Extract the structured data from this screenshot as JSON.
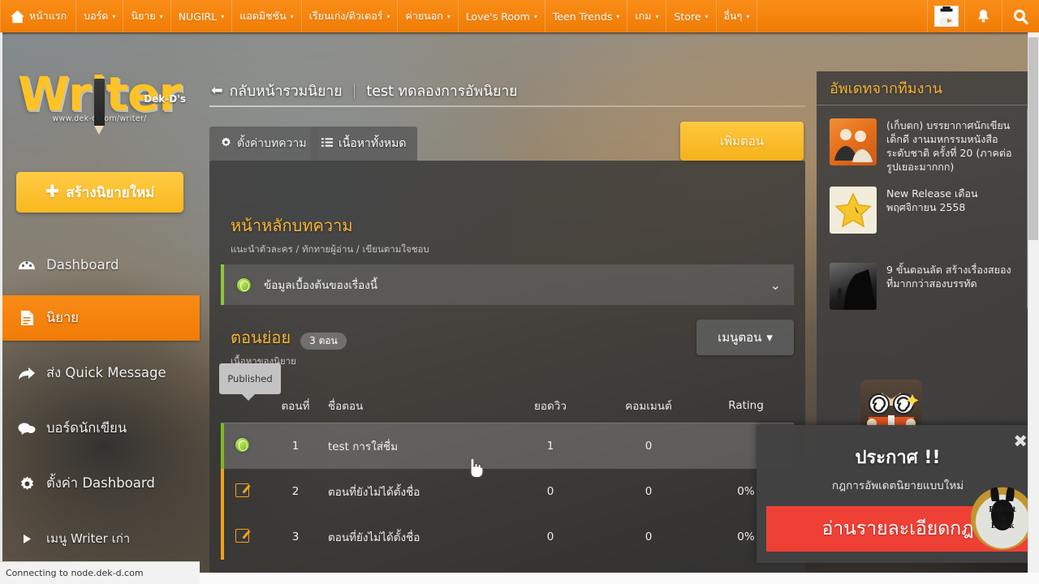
{
  "topnav": {
    "home_label": "หน้าแรก",
    "items": [
      {
        "label": "บอร์ด",
        "caret": "▾"
      },
      {
        "label": "นิยาย",
        "caret": "▾"
      },
      {
        "label": "NUGIRL",
        "caret": "▾"
      },
      {
        "label": "แอดมิชชัน",
        "caret": "▾"
      },
      {
        "label": "เรียนเก่ง/ติวเตอร์",
        "caret": "▾"
      },
      {
        "label": "ค่ายนอก",
        "caret": "▾"
      },
      {
        "label": "Love's Room",
        "caret": "▾"
      },
      {
        "label": "Teen Trends",
        "caret": "▾"
      },
      {
        "label": "เกม",
        "caret": "▾"
      },
      {
        "label": "Store",
        "caret": "▾"
      },
      {
        "label": "อื่นๆ",
        "caret": "▾"
      }
    ],
    "icons": {
      "avatar": "user-avatar",
      "bell": "bell-icon",
      "search": "search-icon"
    }
  },
  "sidebar": {
    "logo": {
      "word": "Writer",
      "sup": "Dek-D's",
      "url": "www.dek-d.com/writer/"
    },
    "create_button": {
      "plus": "✚",
      "label": "สร้างนิยายใหม่"
    },
    "items": [
      {
        "label": "Dashboard",
        "icon": "dashboard-icon",
        "active": false
      },
      {
        "label": "นิยาย",
        "icon": "novel-icon",
        "active": true
      },
      {
        "label": "ส่ง Quick Message",
        "icon": "share-arrow-icon",
        "active": false
      },
      {
        "label": "บอร์ดนักเขียน",
        "icon": "chat-bubble-icon",
        "active": false
      },
      {
        "label": "ตั้งค่า Dashboard",
        "icon": "gear-icon",
        "active": false
      },
      {
        "label": "เมนู Writer เก่า",
        "icon": "triangle-right-icon",
        "active": false
      }
    ]
  },
  "main": {
    "breadcrumb": {
      "back_arrow": "⬅",
      "back_label": "กลับหน้ารวมนิยาย",
      "separator": "|",
      "current": "test ทดลองการอัพนิยาย"
    },
    "tabs": [
      {
        "label": "ตั้งค่าบทความ",
        "icon": "gear-icon",
        "active": false
      },
      {
        "label": "เนื้อหาทั้งหมด",
        "icon": "list-icon",
        "active": true
      }
    ],
    "add_episode_button": "เพิ่มตอน",
    "article_section": {
      "title": "หน้าหลักบทความ",
      "subtitle": "แนะนำตัวละคร / ทักทายผู้อ่าน / เขียนตามใจชอบ",
      "row_label": "ข้อมูลเบื้องต้นของเรื่องนี้",
      "row_icon": "globe-published-icon",
      "row_chevron": "⌄"
    },
    "episodes_section": {
      "title": "ตอนย่อย",
      "badge": "3 ตอน",
      "subtitle": "เนื้อหาของนิยาย",
      "menu_button": "เมนูตอน",
      "menu_caret": "▾"
    },
    "table": {
      "tooltip": "Published",
      "headers": [
        "",
        "ตอนที่",
        "ชื่อตอน",
        "ยอดวิว",
        "คอมเมนต์",
        "Rating"
      ],
      "rows": [
        {
          "status": "published",
          "no": "1",
          "title": "test การใส่ชื่ม",
          "views": "1",
          "comments": "0",
          "rating": "",
          "highlight": true
        },
        {
          "status": "draft",
          "no": "2",
          "title": "ตอนที่ยังไม่ได้ตั้งชื่อ",
          "views": "0",
          "comments": "0",
          "rating": "0%",
          "highlight": false
        },
        {
          "status": "draft",
          "no": "3",
          "title": "ตอนที่ยังไม่ได้ตั้งชื่อ",
          "views": "0",
          "comments": "0",
          "rating": "0%",
          "highlight": false
        }
      ]
    }
  },
  "right_panel": {
    "title": "อัพเดทจากทีมงาน",
    "items": [
      {
        "thumb": "photo",
        "text": "(เก็บตก) บรรยากาศนักเขียนเด็กดี งานมหกรรมหนังสือระดับชาติ ครั้งที่ 20 (ภาคต่อ รูปเยอะมากกก)"
      },
      {
        "thumb": "star",
        "text": "New Release เดือนพฤศจิกายน 2558"
      },
      {
        "thumb": "dark",
        "text": "9 ขั้นตอนลัด สร้างเรื่องสยองที่มากกว่าสองบรรทัด"
      }
    ]
  },
  "popup": {
    "close": "✖",
    "title": "ประกาศ !!",
    "subtitle": "กฎการอัพเดตนิยายแบบใหม่",
    "cta": "อ่านรายละเอียดกฎ",
    "watermark": {
      "line1": "Rabbit",
      "line2": "In",
      "line3": "Black"
    }
  },
  "browser": {
    "status_text": "Connecting to node.dek-d.com"
  },
  "colors": {
    "brand_orange": "#f5840d",
    "accent_yellow": "#f7b531",
    "published_green": "#7cbb1f",
    "draft_orange": "#f0a21d",
    "cta_red": "#ef4036"
  }
}
